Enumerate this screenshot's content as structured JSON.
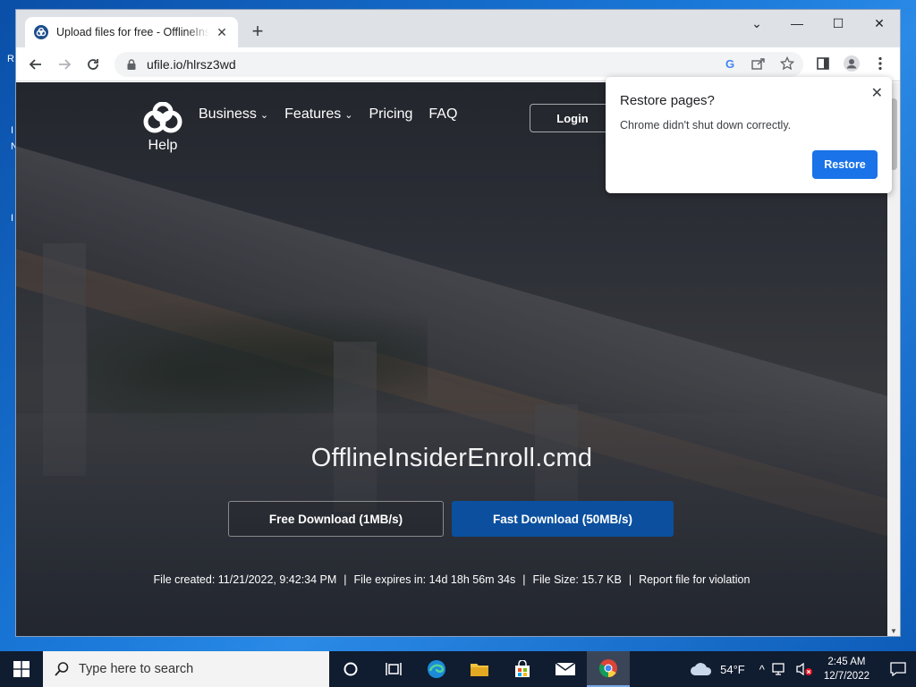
{
  "desktop": {
    "fragments": [
      "R",
      "I",
      "N",
      "I"
    ]
  },
  "browser": {
    "tab_title": "Upload files for free - OfflineInsiderEnroll.cmd - ufile.io",
    "tab_close": "✕",
    "new_tab": "+",
    "url": "ufile.io/hlrsz3wd",
    "window_controls": {
      "minimize": "—",
      "maximize": "☐",
      "close": "✕",
      "tab_search": "⌄"
    }
  },
  "site": {
    "help": "Help",
    "nav": [
      "Business",
      "Features",
      "Pricing",
      "FAQ"
    ],
    "nav_dropdown": [
      true,
      true,
      false,
      false
    ],
    "login": "Login",
    "filename": "OfflineInsiderEnroll.cmd",
    "free_download": "Free Download (1MB/s)",
    "fast_download": "Fast Download (50MB/s)",
    "file_created": "File created: 11/21/2022, 9:42:34 PM",
    "file_expires": "File expires in: 14d 18h 56m 34s",
    "file_size": "File Size: 15.7 KB",
    "report": "Report file for violation",
    "separator": "|"
  },
  "restore_popup": {
    "title": "Restore pages?",
    "message": "Chrome didn't shut down correctly.",
    "button": "Restore",
    "close": "✕"
  },
  "taskbar": {
    "search_placeholder": "Type here to search",
    "weather": "54°F",
    "time": "2:45 AM",
    "date": "12/7/2022"
  },
  "colors": {
    "restore_button": "#1a73e8",
    "fast_download": "#0b4f9e",
    "taskbar": "#101c30"
  }
}
